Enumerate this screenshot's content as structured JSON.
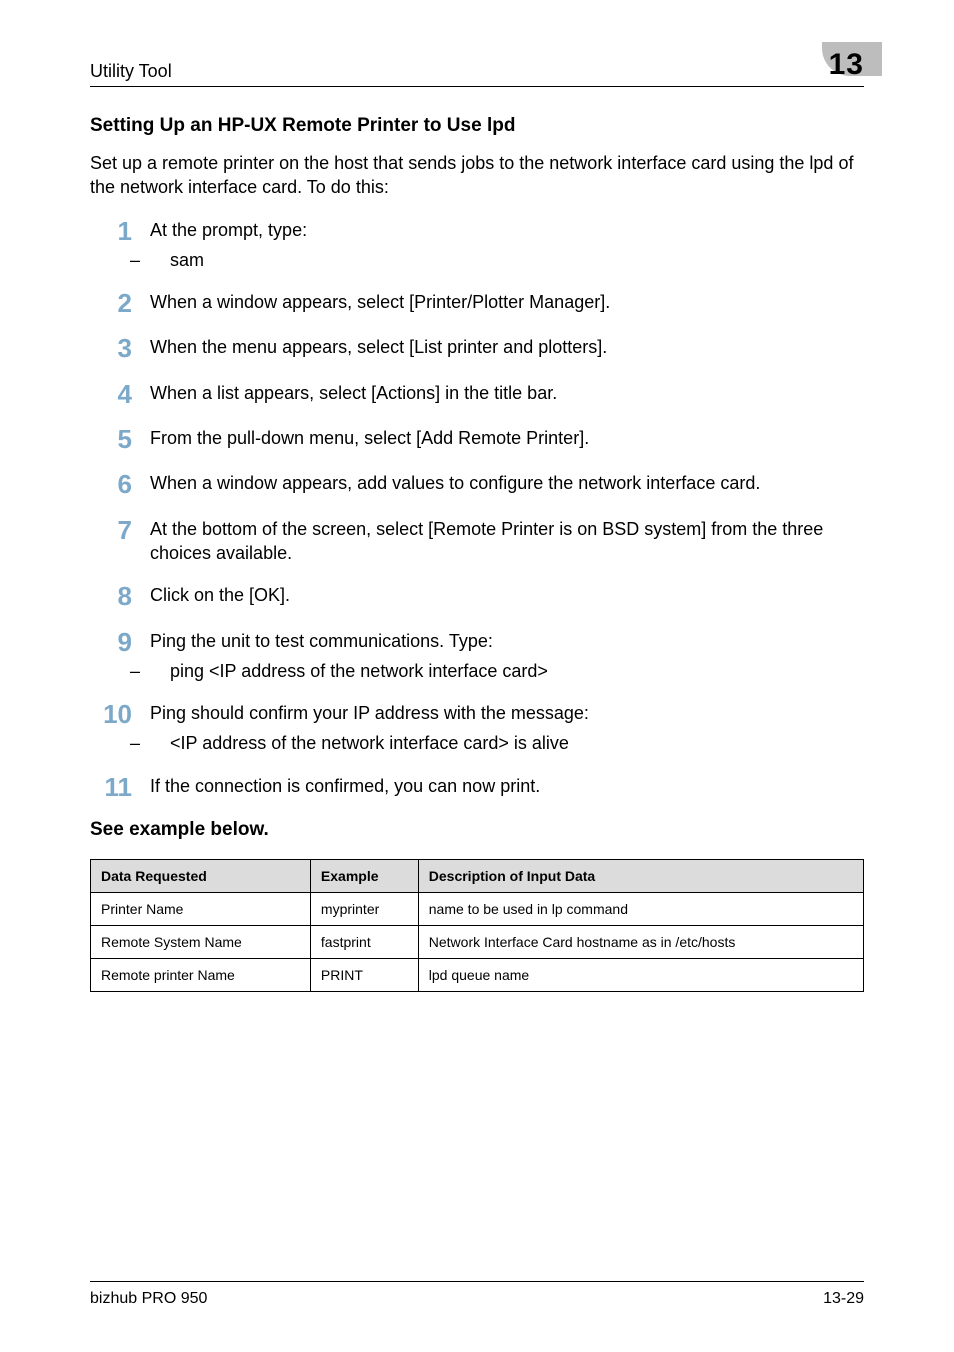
{
  "header": {
    "section": "Utility Tool",
    "chapter": "13"
  },
  "subheading": "Setting Up an HP-UX Remote Printer to Use lpd",
  "intro": "Set up a remote printer on the host that sends jobs to the network interface card using the lpd of the network interface card. To do this:",
  "steps": [
    {
      "n": "1",
      "text": "At the prompt, type:",
      "sub": "sam"
    },
    {
      "n": "2",
      "text": "When a window appears, select [Printer/Plotter Manager]."
    },
    {
      "n": "3",
      "text": "When the menu appears, select [List printer and plotters]."
    },
    {
      "n": "4",
      "text": "When a list appears, select [Actions] in the title bar."
    },
    {
      "n": "5",
      "text": "From the pull-down menu, select [Add Remote Printer]."
    },
    {
      "n": "6",
      "text": "When a window appears, add values to configure the network interface card."
    },
    {
      "n": "7",
      "text": "At the bottom of the screen, select [Remote Printer is on BSD system] from the three choices available."
    },
    {
      "n": "8",
      "text": "Click on the [OK]."
    },
    {
      "n": "9",
      "text": "Ping the unit to test communications. Type:",
      "sub": "ping <IP address of the network interface card>"
    },
    {
      "n": "10",
      "text": "Ping should confirm your IP address with the message:",
      "sub": "<IP address of the network interface card> is alive"
    },
    {
      "n": "11",
      "text": "If the connection is confirmed, you can now print."
    }
  ],
  "see_example": "See example below.",
  "table": {
    "headers": [
      "Data Requested",
      "Example",
      "Description of Input Data"
    ],
    "rows": [
      [
        "Printer Name",
        "myprinter",
        "name to be used in lp command"
      ],
      [
        "Remote System Name",
        "fastprint",
        "Network Interface Card hostname as in /etc/hosts"
      ],
      [
        "Remote printer Name",
        "PRINT",
        "lpd queue name"
      ]
    ]
  },
  "footer": {
    "product": "bizhub PRO 950",
    "page": "13-29"
  }
}
